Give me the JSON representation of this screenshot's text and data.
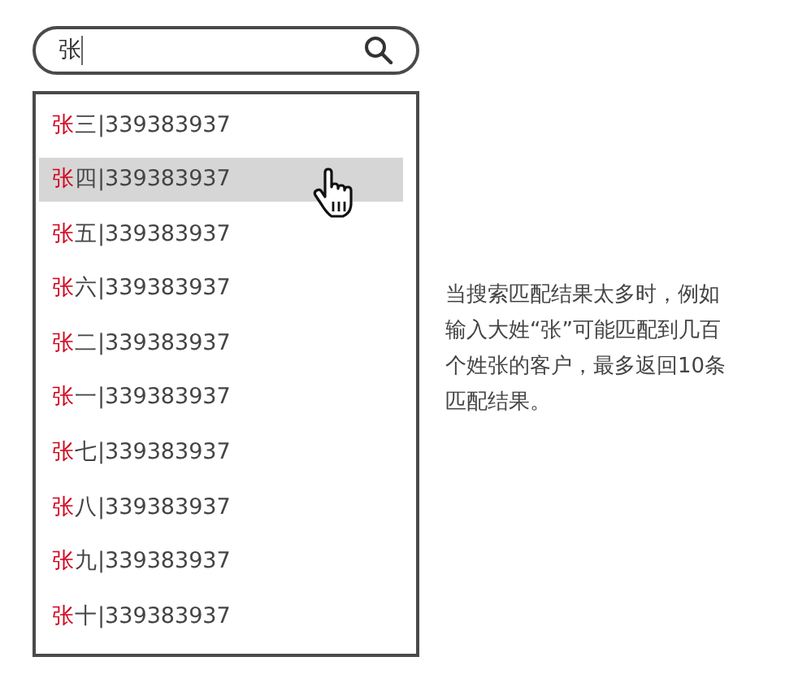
{
  "search": {
    "value": "张"
  },
  "results": [
    {
      "match": "张",
      "rest": "三|339383937",
      "selected": false
    },
    {
      "match": "张",
      "rest": "四|339383937",
      "selected": true
    },
    {
      "match": "张",
      "rest": "五|339383937",
      "selected": false
    },
    {
      "match": "张",
      "rest": "六|339383937",
      "selected": false
    },
    {
      "match": "张",
      "rest": "二|339383937",
      "selected": false
    },
    {
      "match": "张",
      "rest": "一|339383937",
      "selected": false
    },
    {
      "match": "张",
      "rest": "七|339383937",
      "selected": false
    },
    {
      "match": "张",
      "rest": "八|339383937",
      "selected": false
    },
    {
      "match": "张",
      "rest": "九|339383937",
      "selected": false
    },
    {
      "match": "张",
      "rest": "十|339383937",
      "selected": false
    }
  ],
  "note": "当搜索匹配结果太多时，例如输入大姓“张”可能匹配到几百个姓张的客户，最多返回10条匹配结果。"
}
